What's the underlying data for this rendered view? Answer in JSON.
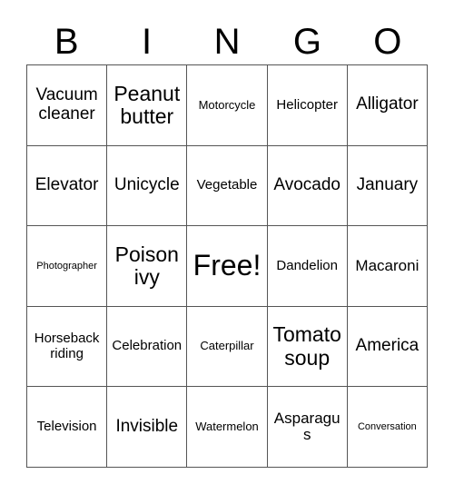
{
  "card": {
    "header_letters": [
      "B",
      "I",
      "N",
      "G",
      "O"
    ],
    "border_color": "#555555",
    "text_color": "#000000",
    "background_color": "#ffffff",
    "rows": 5,
    "columns": 5,
    "cells": [
      [
        {
          "text": "Vacuum cleaner",
          "size": "s-xl"
        },
        {
          "text": "Peanut butter",
          "size": "s-xxl"
        },
        {
          "text": "Motorcycle",
          "size": "s-sm"
        },
        {
          "text": "Helicopter",
          "size": "s-md"
        },
        {
          "text": "Alligator",
          "size": "s-xl"
        }
      ],
      [
        {
          "text": "Elevator",
          "size": "s-xl"
        },
        {
          "text": "Unicycle",
          "size": "s-xl"
        },
        {
          "text": "Vegetable",
          "size": "s-md"
        },
        {
          "text": "Avocado",
          "size": "s-xl"
        },
        {
          "text": "January",
          "size": "s-xl"
        }
      ],
      [
        {
          "text": "Photographer",
          "size": "s-xs"
        },
        {
          "text": "Poison ivy",
          "size": "s-xxl"
        },
        {
          "text": "Free!",
          "size": "s-free"
        },
        {
          "text": "Dandelion",
          "size": "s-md"
        },
        {
          "text": "Macaroni",
          "size": "s-lg"
        }
      ],
      [
        {
          "text": "Horseback riding",
          "size": "s-md"
        },
        {
          "text": "Celebration",
          "size": "s-md"
        },
        {
          "text": "Caterpillar",
          "size": "s-sm"
        },
        {
          "text": "Tomato soup",
          "size": "s-xxl"
        },
        {
          "text": "America",
          "size": "s-xl"
        }
      ],
      [
        {
          "text": "Television",
          "size": "s-md"
        },
        {
          "text": "Invisible",
          "size": "s-xl"
        },
        {
          "text": "Watermelon",
          "size": "s-sm"
        },
        {
          "text": "Asparagus",
          "size": "s-lg"
        },
        {
          "text": "Conversation",
          "size": "s-xs"
        }
      ]
    ]
  }
}
